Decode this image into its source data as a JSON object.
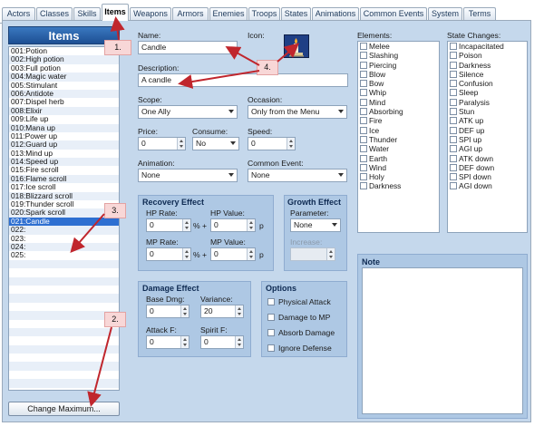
{
  "tabs": [
    "Actors",
    "Classes",
    "Skills",
    "Items",
    "Weapons",
    "Armors",
    "Enemies",
    "Troops",
    "States",
    "Animations",
    "Common Events",
    "System",
    "Terms"
  ],
  "active_tab": "Items",
  "items_panel": {
    "header": "Items",
    "list": [
      "001:Potion",
      "002:High potion",
      "003:Full potion",
      "004:Magic water",
      "005:Stimulant",
      "006:Antidote",
      "007:Dispel herb",
      "008:Elixir",
      "009:Life up",
      "010:Mana up",
      "011:Power up",
      "012:Guard up",
      "013:Mind up",
      "014:Speed up",
      "015:Fire scroll",
      "016:Flame scroll",
      "017:Ice scroll",
      "018:Blizzard scroll",
      "019:Thunder scroll",
      "020:Spark scroll",
      "021:Candle",
      "022:",
      "023:",
      "024:",
      "025:"
    ],
    "selected": "021:Candle",
    "change_button": "Change Maximum..."
  },
  "form": {
    "name_label": "Name:",
    "name_value": "Candle",
    "icon_label": "Icon:",
    "icon_name": "candle-icon",
    "desc_label": "Description:",
    "desc_value": "A candle",
    "scope_label": "Scope:",
    "scope_value": "One Ally",
    "occasion_label": "Occasion:",
    "occasion_value": "Only from the Menu",
    "price_label": "Price:",
    "price_value": "0",
    "consume_label": "Consume:",
    "consume_value": "No",
    "speed_label": "Speed:",
    "speed_value": "0",
    "animation_label": "Animation:",
    "animation_value": "None",
    "common_event_label": "Common Event:",
    "common_event_value": "None"
  },
  "recovery": {
    "title": "Recovery Effect",
    "hp_rate_label": "HP Rate:",
    "hp_rate": "0",
    "hp_value_label": "HP Value:",
    "hp_value": "0",
    "mp_rate_label": "MP Rate:",
    "mp_rate": "0",
    "mp_value_label": "MP Value:",
    "mp_value": "0",
    "pct_plus": "% +",
    "p": "p"
  },
  "growth": {
    "title": "Growth Effect",
    "param_label": "Parameter:",
    "param_value": "None",
    "increase_label": "Increase:"
  },
  "damage": {
    "title": "Damage Effect",
    "base_label": "Base Dmg:",
    "base_value": "0",
    "variance_label": "Variance:",
    "variance_value": "20",
    "attack_label": "Attack F:",
    "attack_value": "0",
    "spirit_label": "Spirit F:",
    "spirit_value": "0"
  },
  "options": {
    "title": "Options",
    "items": [
      "Physical Attack",
      "Damage to MP",
      "Absorb Damage",
      "Ignore Defense"
    ]
  },
  "elements": {
    "title": "Elements:",
    "items": [
      "Melee",
      "Slashing",
      "Piercing",
      "Blow",
      "Bow",
      "Whip",
      "Mind",
      "Absorbing",
      "Fire",
      "Ice",
      "Thunder",
      "Water",
      "Earth",
      "Wind",
      "Holy",
      "Darkness"
    ]
  },
  "state_changes": {
    "title": "State Changes:",
    "items": [
      "Incapacitated",
      "Poison",
      "Darkness",
      "Silence",
      "Confusion",
      "Sleep",
      "Paralysis",
      "Stun",
      "ATK up",
      "DEF up",
      "SPI up",
      "AGI up",
      "ATK down",
      "DEF down",
      "SPI down",
      "AGI down"
    ]
  },
  "note": {
    "title": "Note"
  },
  "callouts": [
    "1.",
    "2.",
    "3.",
    "4."
  ],
  "colors": {
    "accent": "#1d4f93",
    "panel_bg": "#c5d8ec",
    "group_bg": "#aec8e4",
    "callout_arrow": "#c0262d"
  }
}
